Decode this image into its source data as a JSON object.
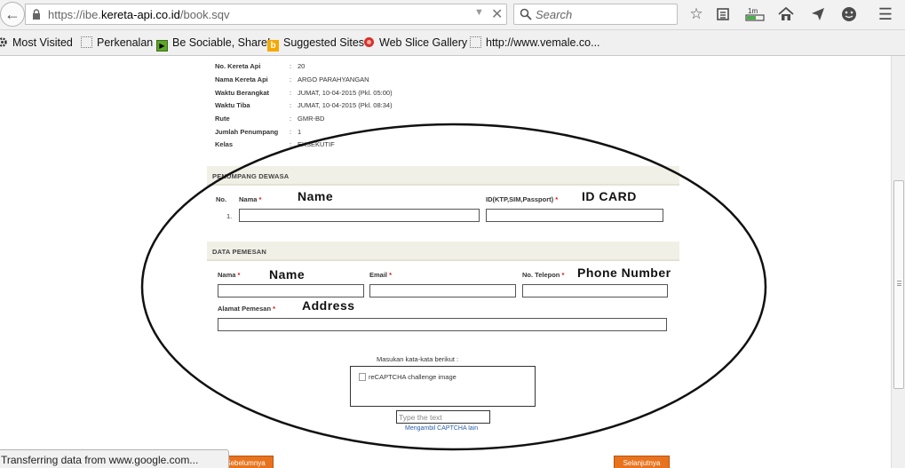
{
  "browser": {
    "url_prefix": "https://ibe.",
    "url_domain": "kereta-api.co.id",
    "url_path": "/book.sqv",
    "search_placeholder": "Search",
    "downloads_badge": "1m",
    "status_text": "Transferring data from www.google.com..."
  },
  "bookmarks": [
    {
      "label": "Most Visited",
      "icon": "gear-icon"
    },
    {
      "label": "Perkenalan",
      "icon": "page-icon"
    },
    {
      "label": "Be Sociable, Share!",
      "icon": "share-icon"
    },
    {
      "label": "Suggested Sites",
      "icon": "bing-icon"
    },
    {
      "label": "Web Slice Gallery",
      "icon": "web-slice-icon"
    },
    {
      "label": "http://www.vemale.co...",
      "icon": "page-icon"
    }
  ],
  "trip_info": [
    {
      "label": "No. Kereta Api",
      "value": "20"
    },
    {
      "label": "Nama Kereta Api",
      "value": "ARGO PARAHYANGAN"
    },
    {
      "label": "Waktu Berangkat",
      "value": "JUMAT, 10-04-2015 (Pkl. 05:00)"
    },
    {
      "label": "Waktu Tiba",
      "value": "JUMAT, 10-04-2015 (Pkl. 08:34)"
    },
    {
      "label": "Rute",
      "value": "GMR-BD"
    },
    {
      "label": "Jumlah Penumpang",
      "value": "1"
    },
    {
      "label": "Kelas",
      "value": "EKSEKUTIF"
    }
  ],
  "passenger_section": {
    "title": "PENUMPANG DEWASA",
    "col_no": "No.",
    "col_name": "Nama",
    "col_id": "ID(KTP,SIM,Passport)",
    "row_no": "1.",
    "required_mark": "*"
  },
  "order_section": {
    "title": "DATA PEMESAN",
    "name_label": "Nama",
    "email_label": "Email",
    "phone_label": "No. Telepon",
    "address_label": "Alamat Pemesan",
    "required_mark": "*"
  },
  "annotations": {
    "name_1": "Name",
    "id_card": "ID CARD",
    "name_2": "Name",
    "phone": "Phone Number",
    "address": "Address"
  },
  "captcha": {
    "prompt": "Masukan kata-kata berikut :",
    "image_alt": "reCAPTCHA challenge image",
    "input_placeholder": "Type the text",
    "refresh_link": "Mengambil CAPTCHA lain"
  },
  "buttons": {
    "prev": "Sebelumnya",
    "next": "Selanjutnya"
  }
}
